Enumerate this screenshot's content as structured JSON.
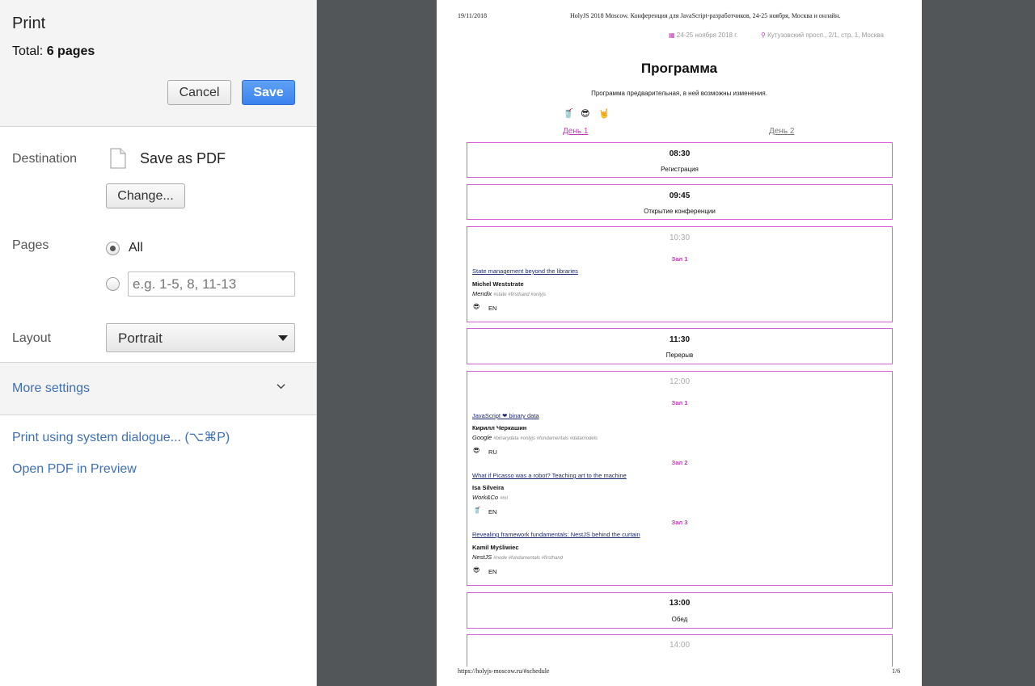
{
  "print_panel": {
    "title": "Print",
    "total_label": "Total:",
    "total_value": "6 pages",
    "cancel_label": "Cancel",
    "save_label": "Save",
    "destination_label": "Destination",
    "destination_value": "Save as PDF",
    "change_label": "Change...",
    "pages_label": "Pages",
    "pages_all_label": "All",
    "pages_all_selected": true,
    "pages_range_placeholder": "e.g. 1-5, 8, 11-13",
    "layout_label": "Layout",
    "layout_value": "Portrait",
    "more_settings_label": "More settings",
    "system_dialogue_label": "Print using system dialogue... (⌥⌘P)",
    "open_pdf_label": "Open PDF in Preview",
    "accent_color": "#3b82ee",
    "link_color": "#3d6fb6"
  },
  "preview": {
    "header_date": "19/11/2018",
    "header_title": "HolyJS 2018 Moscow. Конференция для JavaScript-разработчиков, 24-25 ноября, Москва и онлайн.",
    "event_dates": "24-25 ноября 2018 г.",
    "event_location": "Кутузовский просп., 2/1, стр. 1, Москва",
    "page_title": "Программа",
    "subtitle": "Программа предварительная, в ней возможны изменения.",
    "legend_icons": [
      "🥤",
      "😎",
      "🤘"
    ],
    "day_tabs": [
      "День 1",
      "День 2"
    ],
    "accent_color": "#d75ed3",
    "slots": {
      "s0830": {
        "time": "08:30",
        "caption": "Регистрация"
      },
      "s0945": {
        "time": "09:45",
        "caption": "Открытие конференции"
      },
      "s1030": {
        "time": "10:30",
        "talks": [
          {
            "hall": "Зал 1",
            "title": "State management beyond the libraries",
            "speaker": "Michel Weststrate",
            "company": "Mendix",
            "tags": "#state #firsthand #onlyjs",
            "level_icon": "😎",
            "lang": "EN"
          }
        ]
      },
      "s1130": {
        "time": "11:30",
        "caption": "Перерыв"
      },
      "s1200": {
        "time": "12:00",
        "talks": [
          {
            "hall": "Зал 1",
            "title": "JavaScript ❤ binary data",
            "speaker": "Кирилл Черкашин",
            "company": "Google",
            "tags": "#binarydata #onlyjs #fundamentals #datamodels",
            "level_icon": "😎",
            "lang": "RU"
          },
          {
            "hall": "Зал 2",
            "title": "What if Picasso was a robot? Teaching art to the machine",
            "speaker": "Isa Silveira",
            "company": "Work&Co",
            "tags": "#ml",
            "level_icon": "🥤",
            "lang": "EN"
          },
          {
            "hall": "Зал 3",
            "title": "Revealing framework fundamentals: NestJS behind the curtain",
            "speaker": "Kamil Myśliwiec",
            "company": "NestJS",
            "tags": "#node #fundamentals #firsthand",
            "level_icon": "😎",
            "lang": "EN"
          }
        ]
      },
      "s1300": {
        "time": "13:00",
        "caption": "Обед"
      },
      "s1400": {
        "time": "14:00"
      }
    },
    "footer_url": "https://holyjs-moscow.ru/#schedule",
    "footer_page": "1/6"
  }
}
